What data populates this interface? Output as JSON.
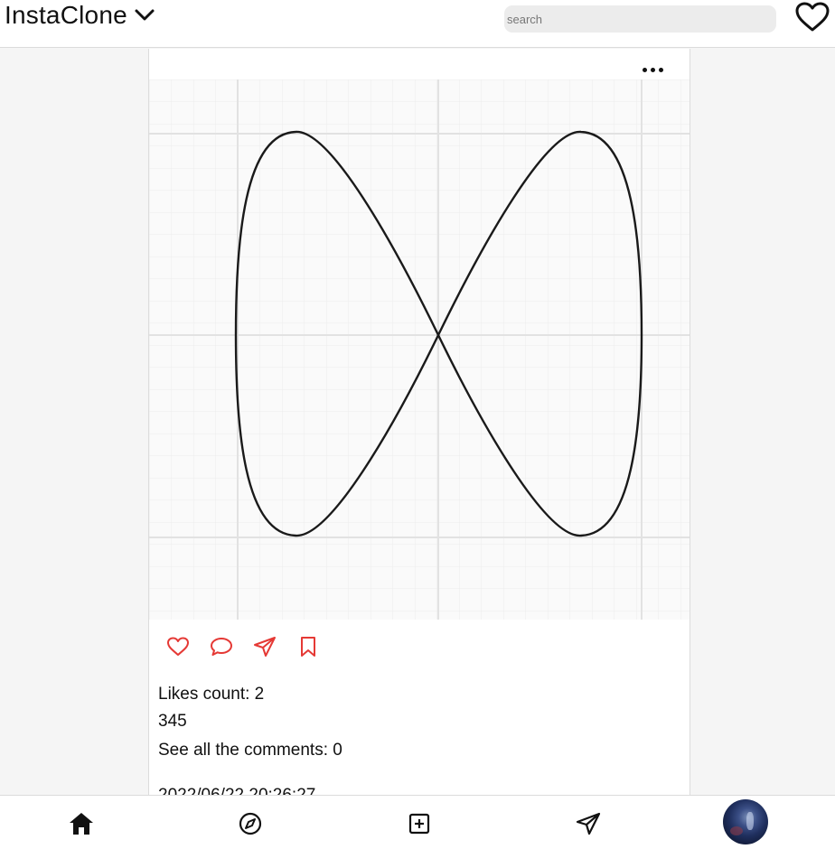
{
  "header": {
    "title": "InstaClone",
    "search_placeholder": "search"
  },
  "post": {
    "likes_text": "Likes count: 2",
    "caption": "345",
    "comments_text": "See all the comments: 0",
    "timestamp": "2022/06/22 20:26:27"
  },
  "colors": {
    "accent": "#e53935",
    "text": "#111111",
    "background": "#f5f5f5"
  },
  "icons": {
    "header": [
      "chevron-down-icon",
      "heart-icon"
    ],
    "post_actions": [
      "heart-icon",
      "comment-icon",
      "share-icon",
      "bookmark-icon"
    ],
    "nav": [
      "home-icon",
      "explore-icon",
      "add-post-icon",
      "direct-message-icon",
      "avatar"
    ]
  }
}
